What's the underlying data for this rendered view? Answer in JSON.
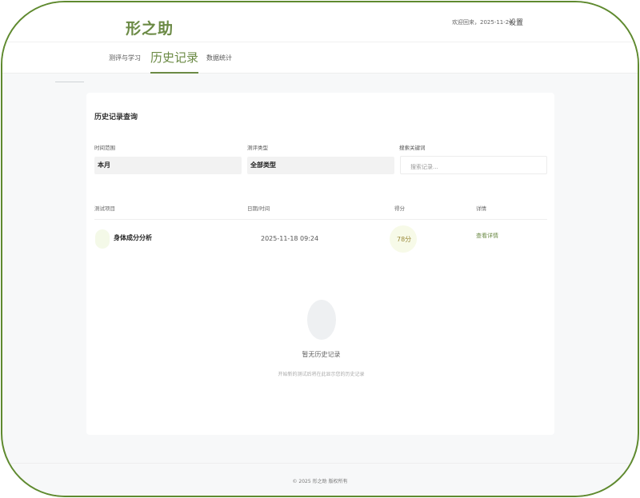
{
  "header": {
    "brand": "形之助",
    "welcome": "欢迎回来，2025-11-24",
    "settings_label": "设置"
  },
  "nav": {
    "tabs": [
      {
        "label": "测评与学习",
        "active": false
      },
      {
        "label": "历史记录",
        "active": true
      },
      {
        "label": "数据统计",
        "active": false
      }
    ]
  },
  "history": {
    "title": "历史记录查询",
    "filters": {
      "time_label": "时间范围",
      "time_value": "本月",
      "type_label": "测评类型",
      "type_value": "全部类型",
      "keyword_label": "搜索关键词",
      "keyword_placeholder": "搜索记录..."
    },
    "table": {
      "columns": [
        "测试项目",
        "日期/时间",
        "得分",
        "详情"
      ],
      "rows": [
        {
          "item": "身体成分分析",
          "datetime": "2025-11-18 09:24",
          "score": "78分",
          "detail_link": "查看详情"
        }
      ]
    },
    "empty": {
      "title": "暂无历史记录",
      "subtitle": "开始新的测试后将在此显示您的历史记录"
    }
  },
  "footer": {
    "text": "© 2025 形之助 版权所有"
  },
  "colors": {
    "brand": "#6b8a45",
    "frame": "#5f8a2f"
  }
}
